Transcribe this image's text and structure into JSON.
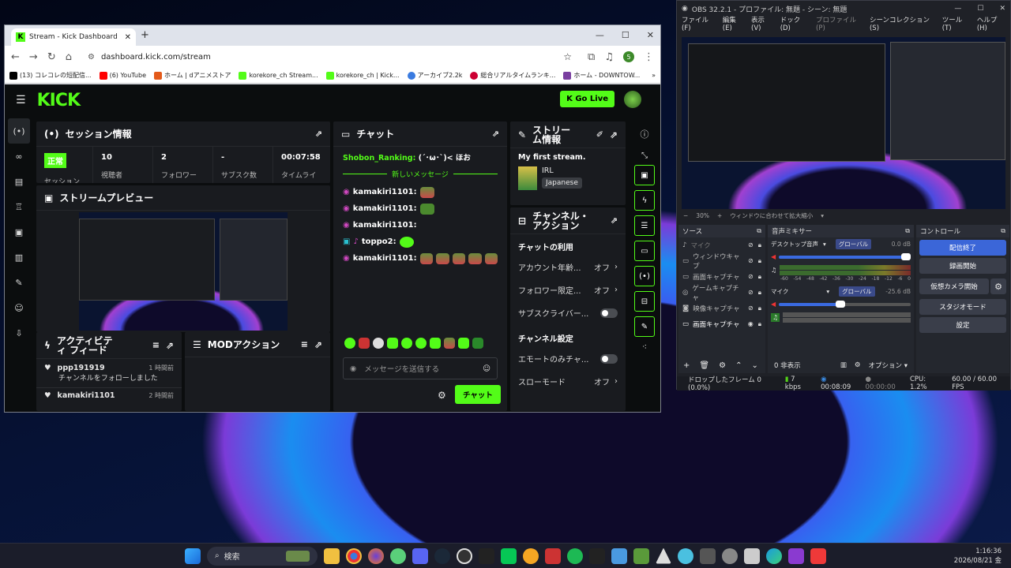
{
  "browser": {
    "tab_title": "Stream - Kick Dashboard",
    "url": "dashboard.kick.com/stream",
    "profile": "5",
    "bookmarks": [
      "(13) コレコレの短配信...",
      "(6) YouTube",
      "ホーム | dアニメストア",
      "korekore_ch Stream...",
      "korekore_ch | Kick...",
      "アーカイブ2.2k",
      "総合リアルタイムランキ...",
      "ホーム - DOWNTOW..."
    ]
  },
  "kick": {
    "logo": "KICK",
    "go_live": "Go Live",
    "session": {
      "title": "セッション情報",
      "stats": [
        {
          "v": "正常",
          "l": "セッション"
        },
        {
          "v": "10",
          "l": "視聴者"
        },
        {
          "v": "2",
          "l": "フォロワー"
        },
        {
          "v": "-",
          "l": "サブスク数"
        },
        {
          "v": "00:07:58",
          "l": "タイムライ"
        }
      ]
    },
    "preview": {
      "title": "ストリームプレビュー"
    },
    "activity": {
      "title": "アクティビティ フィード",
      "items": [
        {
          "user": "ppp191919",
          "time": "1 時間前",
          "text": "チャンネルをフォローしました"
        },
        {
          "user": "kamakiri1101",
          "time": "2 時間前",
          "text": ""
        }
      ]
    },
    "mod": {
      "title": "MODアクション"
    },
    "chat": {
      "title": "チャット",
      "first_user": "Shobon_Ranking:",
      "first_text": "(´･ω･`)< ほお",
      "new_msgs": "新しいメッセージ",
      "messages": [
        {
          "user": "kamakiri1101:"
        },
        {
          "user": "kamakiri1101:"
        },
        {
          "user": "kamakiri1101:"
        },
        {
          "user": "toppo2:"
        },
        {
          "user": "kamakiri1101:"
        }
      ],
      "placeholder": "メッセージを送信する",
      "send": "チャット"
    },
    "streaminfo": {
      "title": "ストリーム情報",
      "stream_title": "My first stream.",
      "category": "IRL",
      "language": "Japanese"
    },
    "channel": {
      "title": "チャンネル・アクション",
      "chat_usage": "チャットの利用",
      "rows": [
        {
          "label": "アカウント年齢...",
          "value": "オフ"
        },
        {
          "label": "フォロワー限定...",
          "value": "オフ"
        },
        {
          "label": "サブスクライバー..."
        }
      ],
      "settings": "チャンネル設定",
      "rows2": [
        {
          "label": "エモートのみチャ..."
        },
        {
          "label": "スローモード",
          "value": "オフ"
        }
      ]
    }
  },
  "obs": {
    "title": "OBS 32.2.1 - プロファイル: 無題 - シーン: 無題",
    "menu": [
      "ファイル(F)",
      "編集(E)",
      "表示(V)",
      "ドック(D)",
      "プロファイル(P)",
      "シーンコレクション(S)",
      "ツール(T)",
      "ヘルプ(H)"
    ],
    "zoom": "30%",
    "zoom_label": "ウィンドウに合わせて拡大縮小",
    "sources_title": "ソース",
    "sources": [
      "マイク",
      "ウィンドウキャプ",
      "画面キャプチャ",
      "ゲームキャプチャ",
      "映像キャプチャ",
      "画面キャプチャ"
    ],
    "mixer_title": "音声ミキサー",
    "mixer": [
      {
        "name": "デスクトップ音声",
        "tag": "グローバル",
        "db": "0.0 dB"
      },
      {
        "name": "マイク",
        "tag": "グローバル",
        "db": "-25.6 dB"
      }
    ],
    "scale": [
      "-60",
      "-54",
      "-48",
      "-42",
      "-36",
      "-30",
      "-24",
      "-18",
      "-12",
      "-6",
      "0"
    ],
    "hidden": "0 非表示",
    "options": "オプション",
    "controls_title": "コントロール",
    "controls": [
      "配信終了",
      "録画開始",
      "仮想カメラ開始",
      "スタジオモード",
      "設定"
    ],
    "status": {
      "dropped": "ドロップしたフレーム 0 (0.0%)",
      "kbps": "7 kbps",
      "stream_time": "00:08:09",
      "rec_time": "00:00:00",
      "cpu": "CPU: 1.2%",
      "fps": "60.00 / 60.00 FPS"
    }
  },
  "taskbar": {
    "search": "検索",
    "time": "1:16:36",
    "date": "2026/08/21 金"
  }
}
